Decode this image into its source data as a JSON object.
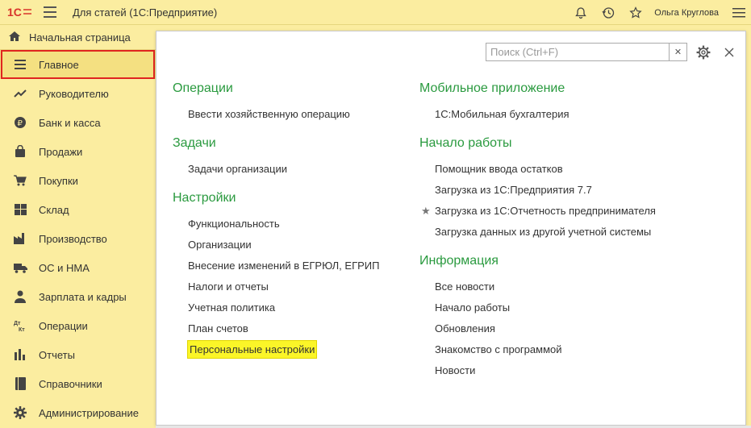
{
  "window": {
    "title": "Для статей  (1С:Предприятие)",
    "user": "Ольга Круглова"
  },
  "sidebar": {
    "home": "Начальная страница",
    "items": [
      {
        "label": "Главное",
        "icon": "list-icon",
        "active": true
      },
      {
        "label": "Руководителю",
        "icon": "trend-icon"
      },
      {
        "label": "Банк и касса",
        "icon": "ruble-icon"
      },
      {
        "label": "Продажи",
        "icon": "bag-icon"
      },
      {
        "label": "Покупки",
        "icon": "cart-icon"
      },
      {
        "label": "Склад",
        "icon": "grid-icon"
      },
      {
        "label": "Производство",
        "icon": "factory-icon"
      },
      {
        "label": "ОС и НМА",
        "icon": "truck-icon"
      },
      {
        "label": "Зарплата и кадры",
        "icon": "person-icon"
      },
      {
        "label": "Операции",
        "icon": "dt-kt-icon"
      },
      {
        "label": "Отчеты",
        "icon": "bar-chart-icon"
      },
      {
        "label": "Справочники",
        "icon": "book-icon"
      },
      {
        "label": "Администрирование",
        "icon": "gear-icon"
      }
    ]
  },
  "panel": {
    "search_placeholder": "Поиск (Ctrl+F)",
    "left": [
      {
        "title": "Операции",
        "links": [
          "Ввести хозяйственную операцию"
        ]
      },
      {
        "title": "Задачи",
        "links": [
          "Задачи организации"
        ]
      },
      {
        "title": "Настройки",
        "links": [
          "Функциональность",
          "Организации",
          "Внесение изменений в ЕГРЮЛ, ЕГРИП",
          "Налоги и отчеты",
          "Учетная политика",
          "План счетов",
          "Персональные настройки"
        ]
      }
    ],
    "right": [
      {
        "title": "Мобильное приложение",
        "links": [
          "1С:Мобильная бухгалтерия"
        ]
      },
      {
        "title": "Начало работы",
        "links": [
          "Помощник ввода остатков",
          "Загрузка из 1С:Предприятия 7.7",
          "Загрузка из 1С:Отчетность предпринимателя",
          "Загрузка данных из другой учетной системы"
        ]
      },
      {
        "title": "Информация",
        "links": [
          "Все новости",
          "Начало работы",
          "Обновления",
          "Знакомство с программой",
          "Новости"
        ]
      }
    ]
  },
  "colors": {
    "accent_green": "#2a9a3f",
    "sidebar_bg": "#fbeda0",
    "active_outline": "#e0241f",
    "highlight": "#fbf528"
  }
}
